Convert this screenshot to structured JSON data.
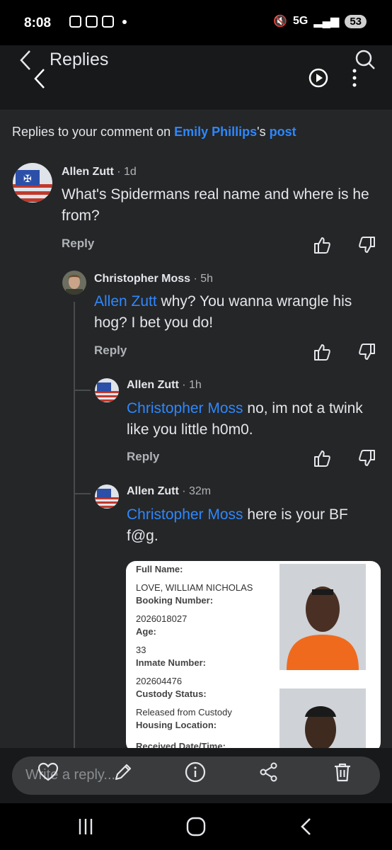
{
  "status": {
    "time": "8:08",
    "network": "5G",
    "battery": "53"
  },
  "header": {
    "title": "Replies"
  },
  "subheader": {
    "prefix": "Replies to your comment on ",
    "author": "Emily Phillips",
    "possessive": "'s ",
    "post": "post"
  },
  "comments": [
    {
      "name": "Allen Zutt",
      "time": "· 1d",
      "text": "What's Spidermans real name and where is he from?",
      "reply": "Reply"
    },
    {
      "name": "Christopher Moss",
      "time": "· 5h",
      "mention": "Allen Zutt",
      "text": " why? You wanna wrangle his hog? I bet you do!",
      "reply": "Reply"
    },
    {
      "name": "Allen Zutt",
      "time": "· 1h",
      "mention": "Christopher Moss",
      "text": " no, im not a twink like you little h0m0.",
      "reply": "Reply"
    },
    {
      "name": "Allen Zutt",
      "time": "· 32m",
      "mention": "Christopher Moss",
      "text": " here is your BF f@g."
    }
  ],
  "attachment": {
    "full_name_label": "Full Name:",
    "full_name": "LOVE, WILLIAM NICHOLAS",
    "booking_label": "Booking Number:",
    "booking": "2026018027",
    "age_label": "Age:",
    "age": "33",
    "inmate_label": "Inmate Number:",
    "inmate": "202604476",
    "custody_label": "Custody Status:",
    "custody": "Released from Custody",
    "housing_label": "Housing Location:",
    "received_label": "Received Date/Time:"
  },
  "composer": {
    "placeholder": "Write a reply..."
  },
  "colors": {
    "accent": "#2d88ff",
    "background": "#252627",
    "header": "#18191a"
  }
}
